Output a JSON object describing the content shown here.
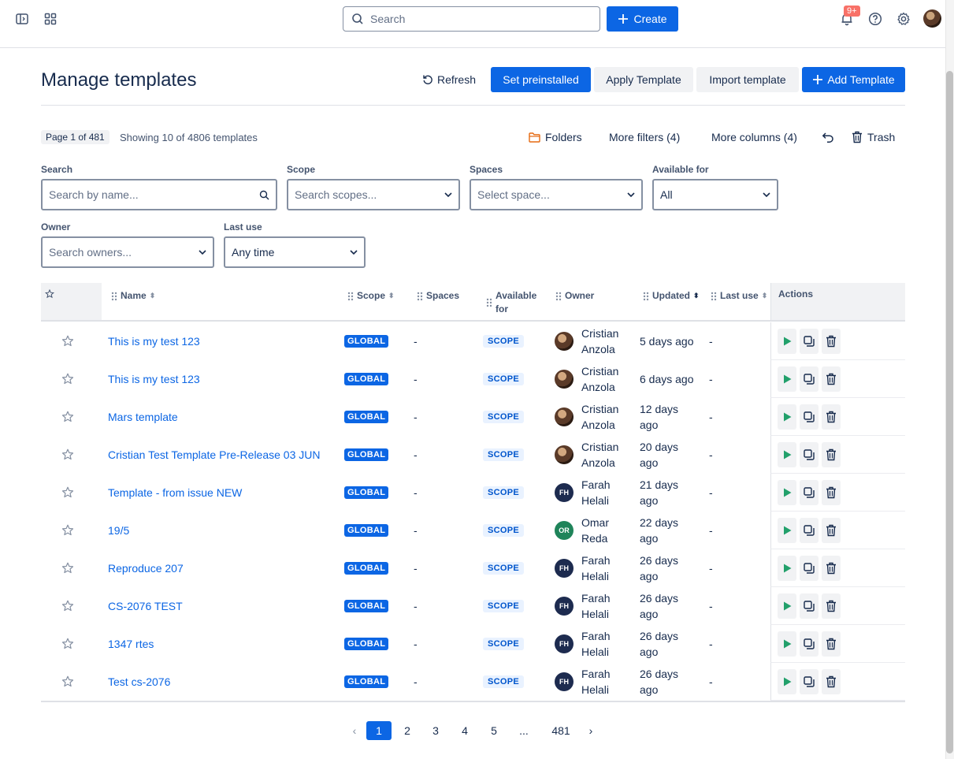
{
  "topbar": {
    "search_placeholder": "Search",
    "create_label": "Create",
    "notifications_badge": "9+"
  },
  "header": {
    "title": "Manage templates",
    "refresh_label": "Refresh",
    "set_preinstalled_label": "Set preinstalled",
    "apply_template_label": "Apply Template",
    "import_template_label": "Import template",
    "add_template_label": "Add Template"
  },
  "toolbar": {
    "page_indicator": "Page 1 of 481",
    "showing_text": "Showing 10 of 4806 templates",
    "folders_label": "Folders",
    "more_filters_label": "More filters (4)",
    "more_columns_label": "More columns (4)",
    "trash_label": "Trash"
  },
  "filters": {
    "search": {
      "label": "Search",
      "placeholder": "Search by name..."
    },
    "scope": {
      "label": "Scope",
      "placeholder": "Search scopes..."
    },
    "spaces": {
      "label": "Spaces",
      "placeholder": "Select space..."
    },
    "available_for": {
      "label": "Available for",
      "value": "All"
    },
    "owner": {
      "label": "Owner",
      "placeholder": "Search owners..."
    },
    "last_use": {
      "label": "Last use",
      "value": "Any time"
    }
  },
  "table": {
    "columns": {
      "name": "Name",
      "scope": "Scope",
      "spaces": "Spaces",
      "available_for_1": "Available",
      "available_for_2": "for",
      "owner": "Owner",
      "updated": "Updated",
      "last_use": "Last use",
      "actions": "Actions"
    },
    "rows": [
      {
        "name": "This is my test 123",
        "scope": "GLOBAL",
        "spaces": "-",
        "available": "SCOPE",
        "owner_first": "Cristian",
        "owner_last": "Anzola",
        "avatar": "photo",
        "initials": "",
        "updated_1": "5 days ago",
        "updated_2": "",
        "last_use": "-"
      },
      {
        "name": "This is my test 123",
        "scope": "GLOBAL",
        "spaces": "-",
        "available": "SCOPE",
        "owner_first": "Cristian",
        "owner_last": "Anzola",
        "avatar": "photo",
        "initials": "",
        "updated_1": "6 days ago",
        "updated_2": "",
        "last_use": "-"
      },
      {
        "name": "Mars template",
        "scope": "GLOBAL",
        "spaces": "-",
        "available": "SCOPE",
        "owner_first": "Cristian",
        "owner_last": "Anzola",
        "avatar": "photo",
        "initials": "",
        "updated_1": "12 days",
        "updated_2": "ago",
        "last_use": "-"
      },
      {
        "name": "Cristian Test Template Pre-Release 03 JUN",
        "scope": "GLOBAL",
        "spaces": "-",
        "available": "SCOPE",
        "owner_first": "Cristian",
        "owner_last": "Anzola",
        "avatar": "photo",
        "initials": "",
        "updated_1": "20 days",
        "updated_2": "ago",
        "last_use": "-"
      },
      {
        "name": "Template - from issue NEW",
        "scope": "GLOBAL",
        "spaces": "-",
        "available": "SCOPE",
        "owner_first": "Farah",
        "owner_last": "Helali",
        "avatar": "fh",
        "initials": "FH",
        "updated_1": "21 days",
        "updated_2": "ago",
        "last_use": "-"
      },
      {
        "name": "19/5",
        "scope": "GLOBAL",
        "spaces": "-",
        "available": "SCOPE",
        "owner_first": "Omar",
        "owner_last": "Reda",
        "avatar": "or",
        "initials": "OR",
        "updated_1": "22 days",
        "updated_2": "ago",
        "last_use": "-"
      },
      {
        "name": "Reproduce 207",
        "scope": "GLOBAL",
        "spaces": "-",
        "available": "SCOPE",
        "owner_first": "Farah",
        "owner_last": "Helali",
        "avatar": "fh",
        "initials": "FH",
        "updated_1": "26 days",
        "updated_2": "ago",
        "last_use": "-"
      },
      {
        "name": "CS-2076 TEST",
        "scope": "GLOBAL",
        "spaces": "-",
        "available": "SCOPE",
        "owner_first": "Farah",
        "owner_last": "Helali",
        "avatar": "fh",
        "initials": "FH",
        "updated_1": "26 days",
        "updated_2": "ago",
        "last_use": "-"
      },
      {
        "name": "1347 rtes",
        "scope": "GLOBAL",
        "spaces": "-",
        "available": "SCOPE",
        "owner_first": "Farah",
        "owner_last": "Helali",
        "avatar": "fh",
        "initials": "FH",
        "updated_1": "26 days",
        "updated_2": "ago",
        "last_use": "-"
      },
      {
        "name": "Test cs-2076",
        "scope": "GLOBAL",
        "spaces": "-",
        "available": "SCOPE",
        "owner_first": "Farah",
        "owner_last": "Helali",
        "avatar": "fh",
        "initials": "FH",
        "updated_1": "26 days",
        "updated_2": "ago",
        "last_use": "-"
      }
    ]
  },
  "pagination": {
    "pages": [
      "1",
      "2",
      "3",
      "4",
      "5",
      "...",
      "481"
    ],
    "current": "1"
  },
  "colors": {
    "primary": "#0c66e4",
    "play_green": "#22a06b",
    "folder_orange": "#e56910",
    "badge_red": "#f87168"
  }
}
